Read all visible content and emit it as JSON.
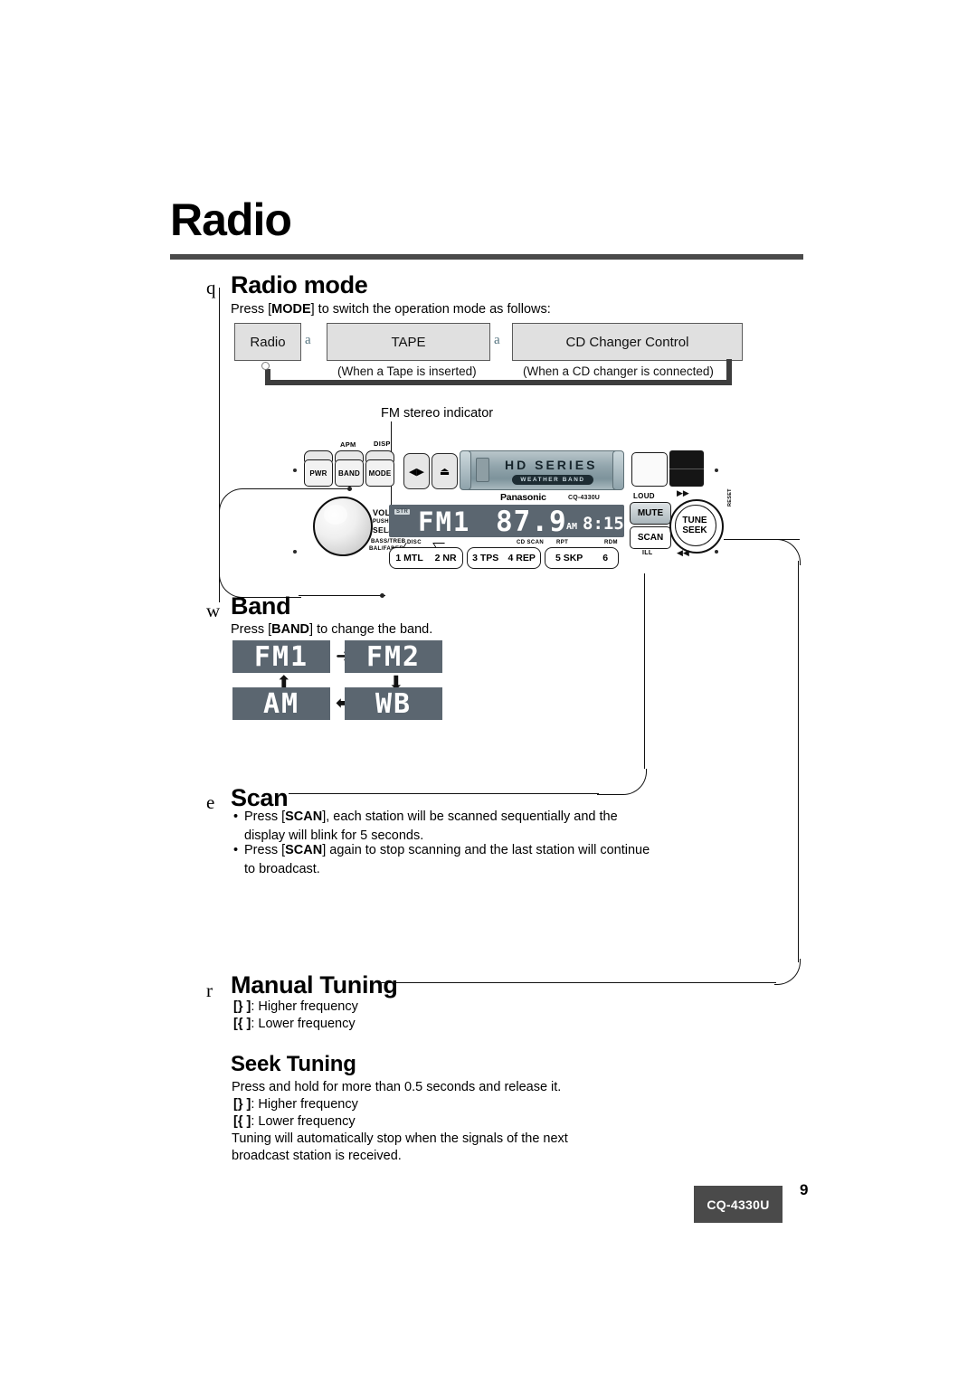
{
  "document": {
    "title": "Radio",
    "page_number": "9",
    "model_badge": "CQ-4330U"
  },
  "sections": {
    "radio_mode": {
      "marker": "q",
      "heading": "Radio mode",
      "intro_pre": "Press [",
      "intro_key": "MODE",
      "intro_post": "] to switch the operation mode as follows:",
      "flow": {
        "boxes": [
          {
            "label": "Radio",
            "note": ""
          },
          {
            "label": "TAPE",
            "note": "(When a Tape is inserted)"
          },
          {
            "label": "CD Changer Control",
            "note": "(When a CD changer is connected)"
          }
        ],
        "arrow_glyph": "a"
      }
    },
    "band": {
      "marker": "w",
      "heading": "Band",
      "intro_pre": "Press [",
      "intro_key": "BAND",
      "intro_post": "] to change the band.",
      "cycle": [
        {
          "label": "FM1"
        },
        {
          "label": "FM2"
        },
        {
          "label": "WB"
        },
        {
          "label": "AM"
        }
      ],
      "arrows": {
        "right": "➜",
        "down": "⬇",
        "left": "⬅",
        "up": "⬆"
      }
    },
    "scan": {
      "marker": "e",
      "heading": "Scan",
      "bullets": [
        {
          "pre": "Press [",
          "key": "SCAN",
          "post": "], each station will be scanned sequentially and the display will blink for 5 seconds."
        },
        {
          "pre": "Press [",
          "key": "SCAN",
          "post": "] again to stop scanning and the last station will continue to broadcast."
        }
      ]
    },
    "manual_tuning": {
      "marker": "r",
      "heading": "Manual Tuning",
      "lines": [
        {
          "symbol": "[}    ]",
          "text": ": Higher frequency"
        },
        {
          "symbol": "[{    ]",
          "text": ": Lower frequency"
        }
      ]
    },
    "seek_tuning": {
      "heading": "Seek Tuning",
      "intro": "Press and hold for more than 0.5 seconds and release it.",
      "lines": [
        {
          "symbol": "[}    ]",
          "text": ": Higher frequency"
        },
        {
          "symbol": "[{    ]",
          "text": ": Lower frequency"
        }
      ],
      "outro_line1": "Tuning will automatically stop when the signals of the next",
      "outro_line2": "broadcast station is received."
    }
  },
  "unit_diagram": {
    "callout_label": "FM stereo indicator",
    "left_controls": {
      "top_labels": [
        "APM",
        "DISP"
      ],
      "buttons": [
        "PWR",
        "BAND",
        "MODE"
      ],
      "knob_labels": [
        "VOL",
        "PUSH",
        "SEL/SAT",
        "BASS/TREB",
        "BAL/FADER"
      ]
    },
    "face_buttons": {
      "scroll": "◀▶",
      "eject": "⏏"
    },
    "faceplate": {
      "series": "HD SERIES",
      "badge": "WEATHER BAND",
      "brand": "Panasonic",
      "model": "CQ-4330U"
    },
    "lcd": {
      "stereo_indicator": "STR",
      "band": "FM1",
      "frequency": "87.9",
      "am_pm": "AM",
      "clock": "8:15"
    },
    "preset_row": {
      "mini_labels": [
        "DISC",
        "CD SCAN",
        "RPT",
        "RDM"
      ],
      "groups": [
        [
          "1 MTL",
          "2 NR"
        ],
        [
          "3 TPS",
          "4 REP"
        ],
        [
          "5 SKP",
          "6"
        ]
      ]
    },
    "right_controls": {
      "loud_label": "LOUD",
      "mute_button": "MUTE",
      "scan_button": "SCAN",
      "ill_label": "ILL",
      "tune_line1": "TUNE",
      "tune_line2": "SEEK",
      "ff_glyph": "▶▶",
      "rew_glyph": "◀◀",
      "side_label": "RESET"
    }
  }
}
